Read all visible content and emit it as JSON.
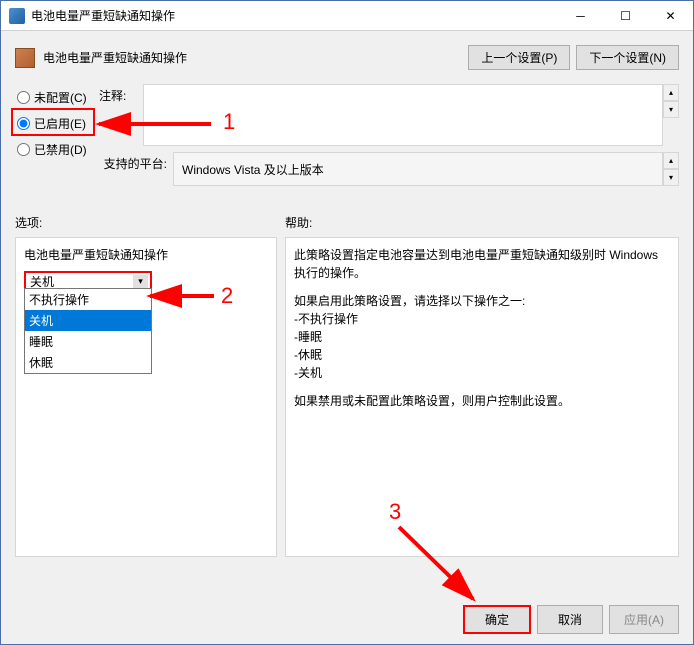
{
  "window": {
    "title": "电池电量严重短缺通知操作"
  },
  "header": {
    "title": "电池电量严重短缺通知操作"
  },
  "nav": {
    "prev": "上一个设置(P)",
    "next": "下一个设置(N)"
  },
  "radios": {
    "not_configured": "未配置(C)",
    "enabled": "已启用(E)",
    "disabled": "已禁用(D)"
  },
  "labels": {
    "comment": "注释:",
    "platform": "支持的平台:",
    "options": "选项:",
    "help": "帮助:"
  },
  "platform_text": "Windows Vista 及以上版本",
  "options_panel": {
    "group_title": "电池电量严重短缺通知操作",
    "selected": "关机",
    "items": [
      "不执行操作",
      "关机",
      "睡眠",
      "休眠"
    ]
  },
  "help_text": {
    "p1": "此策略设置指定电池容量达到电池电量严重短缺通知级别时 Windows 执行的操作。",
    "p2": "如果启用此策略设置，请选择以下操作之一:",
    "li1": "-不执行操作",
    "li2": "-睡眠",
    "li3": "-休眠",
    "li4": "-关机",
    "p3": "如果禁用或未配置此策略设置，则用户控制此设置。"
  },
  "footer": {
    "ok": "确定",
    "cancel": "取消",
    "apply": "应用(A)"
  },
  "annotations": {
    "a1": "1",
    "a2": "2",
    "a3": "3"
  }
}
